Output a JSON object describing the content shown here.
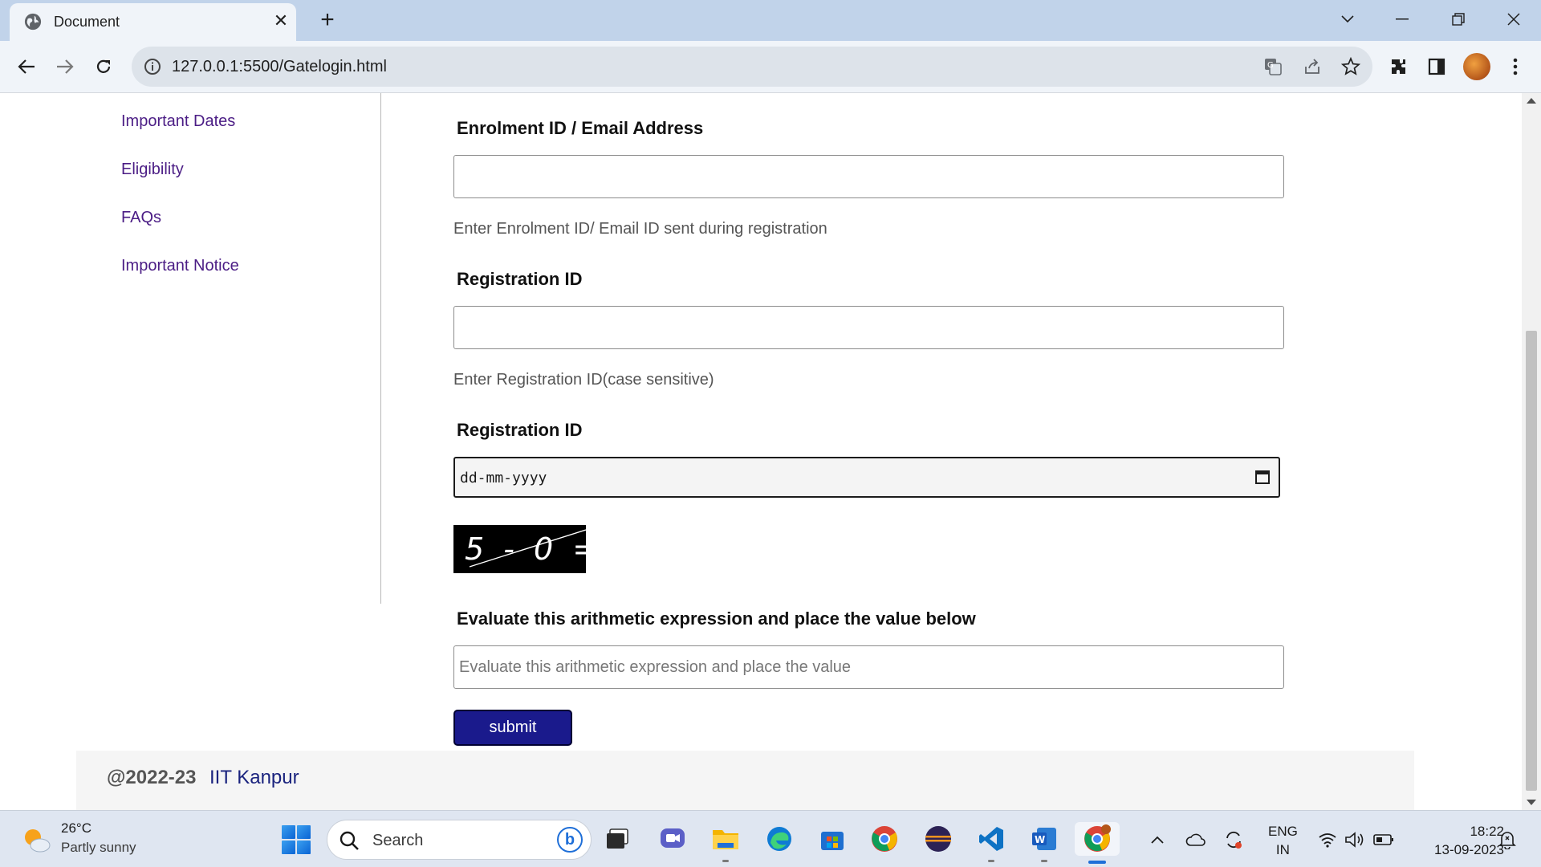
{
  "browser": {
    "tab_title": "Document",
    "url": "127.0.0.1:5500/Gatelogin.html"
  },
  "sidebar": {
    "links": [
      {
        "label": "Important Dates"
      },
      {
        "label": "Eligibility"
      },
      {
        "label": "FAQs"
      },
      {
        "label": "Important Notice"
      }
    ]
  },
  "form": {
    "enrolment": {
      "label": "Enrolment ID / Email Address",
      "value": "",
      "hint": "Enter Enrolment ID/ Email ID sent during registration"
    },
    "registration": {
      "label": "Registration ID",
      "value": "",
      "hint": "Enter Registration ID(case sensitive)"
    },
    "date": {
      "label": "Registration ID",
      "placeholder": "dd-mm-yyyy"
    },
    "captcha": {
      "expression": "5 - 0 ="
    },
    "evaluate": {
      "label": "Evaluate this arithmetic expression and place the value below",
      "placeholder": "Evaluate this arithmetic expression and place the value"
    },
    "submit_label": "submit"
  },
  "footer": {
    "copyright": "@2022-23",
    "org": "IIT Kanpur"
  },
  "taskbar": {
    "weather_temp": "26°C",
    "weather_desc": "Partly sunny",
    "search_label": "Search",
    "lang_line1": "ENG",
    "lang_line2": "IN",
    "time": "18:22",
    "date": "13-09-2023"
  },
  "colors": {
    "link": "#4b1d85",
    "submit_bg": "#1a1a8c",
    "footer_org": "#1a237e",
    "tabbar_bg": "#c1d3ea"
  }
}
